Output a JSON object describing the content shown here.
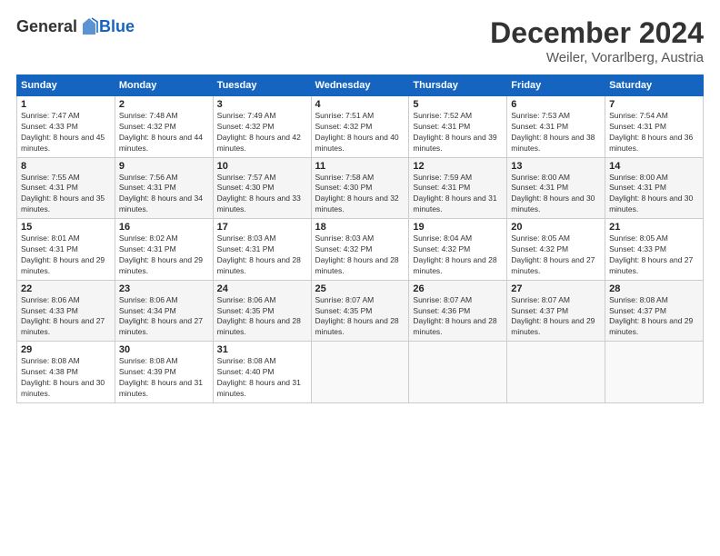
{
  "header": {
    "logo_general": "General",
    "logo_blue": "Blue",
    "month_title": "December 2024",
    "subtitle": "Weiler, Vorarlberg, Austria"
  },
  "weekdays": [
    "Sunday",
    "Monday",
    "Tuesday",
    "Wednesday",
    "Thursday",
    "Friday",
    "Saturday"
  ],
  "weeks": [
    [
      {
        "day": "1",
        "sunrise": "7:47 AM",
        "sunset": "4:33 PM",
        "daylight": "8 hours and 45 minutes."
      },
      {
        "day": "2",
        "sunrise": "7:48 AM",
        "sunset": "4:32 PM",
        "daylight": "8 hours and 44 minutes."
      },
      {
        "day": "3",
        "sunrise": "7:49 AM",
        "sunset": "4:32 PM",
        "daylight": "8 hours and 42 minutes."
      },
      {
        "day": "4",
        "sunrise": "7:51 AM",
        "sunset": "4:32 PM",
        "daylight": "8 hours and 40 minutes."
      },
      {
        "day": "5",
        "sunrise": "7:52 AM",
        "sunset": "4:31 PM",
        "daylight": "8 hours and 39 minutes."
      },
      {
        "day": "6",
        "sunrise": "7:53 AM",
        "sunset": "4:31 PM",
        "daylight": "8 hours and 38 minutes."
      },
      {
        "day": "7",
        "sunrise": "7:54 AM",
        "sunset": "4:31 PM",
        "daylight": "8 hours and 36 minutes."
      }
    ],
    [
      {
        "day": "8",
        "sunrise": "7:55 AM",
        "sunset": "4:31 PM",
        "daylight": "8 hours and 35 minutes."
      },
      {
        "day": "9",
        "sunrise": "7:56 AM",
        "sunset": "4:31 PM",
        "daylight": "8 hours and 34 minutes."
      },
      {
        "day": "10",
        "sunrise": "7:57 AM",
        "sunset": "4:30 PM",
        "daylight": "8 hours and 33 minutes."
      },
      {
        "day": "11",
        "sunrise": "7:58 AM",
        "sunset": "4:30 PM",
        "daylight": "8 hours and 32 minutes."
      },
      {
        "day": "12",
        "sunrise": "7:59 AM",
        "sunset": "4:31 PM",
        "daylight": "8 hours and 31 minutes."
      },
      {
        "day": "13",
        "sunrise": "8:00 AM",
        "sunset": "4:31 PM",
        "daylight": "8 hours and 30 minutes."
      },
      {
        "day": "14",
        "sunrise": "8:00 AM",
        "sunset": "4:31 PM",
        "daylight": "8 hours and 30 minutes."
      }
    ],
    [
      {
        "day": "15",
        "sunrise": "8:01 AM",
        "sunset": "4:31 PM",
        "daylight": "8 hours and 29 minutes."
      },
      {
        "day": "16",
        "sunrise": "8:02 AM",
        "sunset": "4:31 PM",
        "daylight": "8 hours and 29 minutes."
      },
      {
        "day": "17",
        "sunrise": "8:03 AM",
        "sunset": "4:31 PM",
        "daylight": "8 hours and 28 minutes."
      },
      {
        "day": "18",
        "sunrise": "8:03 AM",
        "sunset": "4:32 PM",
        "daylight": "8 hours and 28 minutes."
      },
      {
        "day": "19",
        "sunrise": "8:04 AM",
        "sunset": "4:32 PM",
        "daylight": "8 hours and 28 minutes."
      },
      {
        "day": "20",
        "sunrise": "8:05 AM",
        "sunset": "4:32 PM",
        "daylight": "8 hours and 27 minutes."
      },
      {
        "day": "21",
        "sunrise": "8:05 AM",
        "sunset": "4:33 PM",
        "daylight": "8 hours and 27 minutes."
      }
    ],
    [
      {
        "day": "22",
        "sunrise": "8:06 AM",
        "sunset": "4:33 PM",
        "daylight": "8 hours and 27 minutes."
      },
      {
        "day": "23",
        "sunrise": "8:06 AM",
        "sunset": "4:34 PM",
        "daylight": "8 hours and 27 minutes."
      },
      {
        "day": "24",
        "sunrise": "8:06 AM",
        "sunset": "4:35 PM",
        "daylight": "8 hours and 28 minutes."
      },
      {
        "day": "25",
        "sunrise": "8:07 AM",
        "sunset": "4:35 PM",
        "daylight": "8 hours and 28 minutes."
      },
      {
        "day": "26",
        "sunrise": "8:07 AM",
        "sunset": "4:36 PM",
        "daylight": "8 hours and 28 minutes."
      },
      {
        "day": "27",
        "sunrise": "8:07 AM",
        "sunset": "4:37 PM",
        "daylight": "8 hours and 29 minutes."
      },
      {
        "day": "28",
        "sunrise": "8:08 AM",
        "sunset": "4:37 PM",
        "daylight": "8 hours and 29 minutes."
      }
    ],
    [
      {
        "day": "29",
        "sunrise": "8:08 AM",
        "sunset": "4:38 PM",
        "daylight": "8 hours and 30 minutes."
      },
      {
        "day": "30",
        "sunrise": "8:08 AM",
        "sunset": "4:39 PM",
        "daylight": "8 hours and 31 minutes."
      },
      {
        "day": "31",
        "sunrise": "8:08 AM",
        "sunset": "4:40 PM",
        "daylight": "8 hours and 31 minutes."
      },
      null,
      null,
      null,
      null
    ]
  ]
}
